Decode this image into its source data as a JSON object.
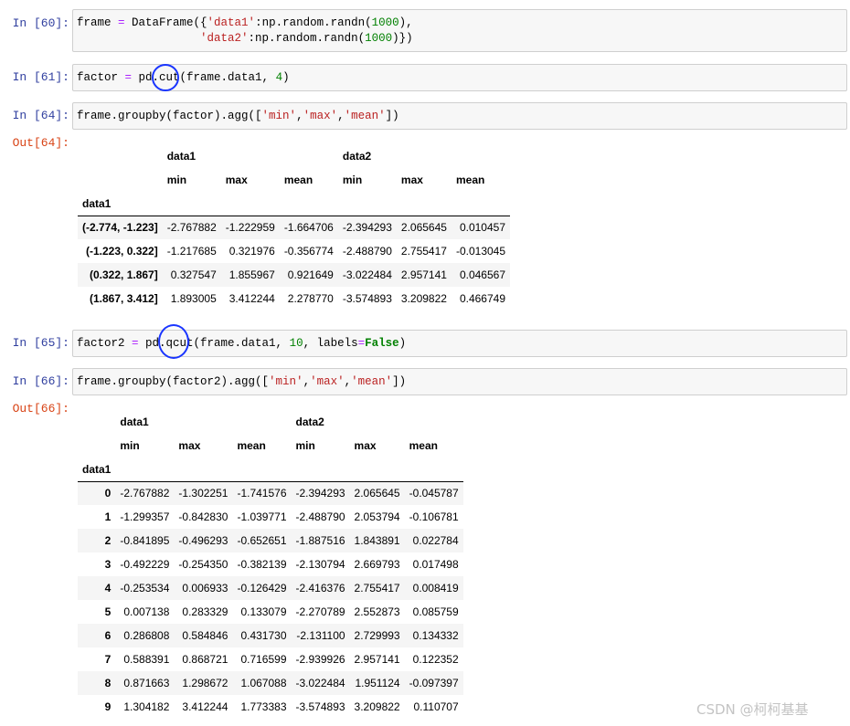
{
  "cells": [
    {
      "prompt": "In  [60]:",
      "lines": [
        [
          [
            "n",
            "frame "
          ],
          [
            "o",
            "="
          ],
          [
            "n",
            " DataFrame({"
          ],
          [
            "s",
            "'data1'"
          ],
          [
            "n",
            ":np.random.randn("
          ],
          [
            "m",
            "1000"
          ],
          [
            "n",
            "),"
          ]
        ],
        [
          [
            "n",
            "                  "
          ],
          [
            "s",
            "'data2'"
          ],
          [
            "n",
            ":np.random.randn("
          ],
          [
            "m",
            "1000"
          ],
          [
            "n",
            ")})"
          ]
        ]
      ]
    },
    {
      "prompt": "In  [61]:",
      "lines": [
        [
          [
            "n",
            "factor "
          ],
          [
            "o",
            "="
          ],
          [
            "n",
            " pd.cut(frame.data1, "
          ],
          [
            "m",
            "4"
          ],
          [
            "n",
            ")"
          ]
        ]
      ]
    },
    {
      "prompt": "In  [64]:",
      "lines": [
        [
          [
            "n",
            "frame.groupby(factor).agg(["
          ],
          [
            "s",
            "'min'"
          ],
          [
            "n",
            ","
          ],
          [
            "s",
            "'max'"
          ],
          [
            "n",
            ","
          ],
          [
            "s",
            "'mean'"
          ],
          [
            "n",
            "])"
          ]
        ]
      ]
    },
    {
      "prompt": "In  [65]:",
      "lines": [
        [
          [
            "n",
            "factor2 "
          ],
          [
            "o",
            "="
          ],
          [
            "n",
            " pd.qcut(frame.data1, "
          ],
          [
            "m",
            "10"
          ],
          [
            "n",
            ", labels"
          ],
          [
            "o",
            "="
          ],
          [
            "k",
            "False"
          ],
          [
            "n",
            ")"
          ]
        ]
      ]
    },
    {
      "prompt": "In  [66]:",
      "lines": [
        [
          [
            "n",
            "frame.groupby(factor2).agg(["
          ],
          [
            "s",
            "'min'"
          ],
          [
            "n",
            ","
          ],
          [
            "s",
            "'max'"
          ],
          [
            "n",
            ","
          ],
          [
            "s",
            "'mean'"
          ],
          [
            "n",
            "])"
          ]
        ]
      ]
    }
  ],
  "outputs": [
    {
      "prompt": "Out[64]:",
      "top_headers": [
        "data1",
        "data2"
      ],
      "sub_headers": [
        "min",
        "max",
        "mean",
        "min",
        "max",
        "mean"
      ],
      "index_name": "data1",
      "rows": [
        {
          "index": "(-2.774, -1.223]",
          "values": [
            "-2.767882",
            "-1.222959",
            "-1.664706",
            "-2.394293",
            "2.065645",
            "0.010457"
          ]
        },
        {
          "index": "(-1.223, 0.322]",
          "values": [
            "-1.217685",
            "0.321976",
            "-0.356774",
            "-2.488790",
            "2.755417",
            "-0.013045"
          ]
        },
        {
          "index": "(0.322, 1.867]",
          "values": [
            "0.327547",
            "1.855967",
            "0.921649",
            "-3.022484",
            "2.957141",
            "0.046567"
          ]
        },
        {
          "index": "(1.867, 3.412]",
          "values": [
            "1.893005",
            "3.412244",
            "2.278770",
            "-3.574893",
            "3.209822",
            "0.466749"
          ]
        }
      ]
    },
    {
      "prompt": "Out[66]:",
      "top_headers": [
        "data1",
        "data2"
      ],
      "sub_headers": [
        "min",
        "max",
        "mean",
        "min",
        "max",
        "mean"
      ],
      "index_name": "data1",
      "rows": [
        {
          "index": "0",
          "values": [
            "-2.767882",
            "-1.302251",
            "-1.741576",
            "-2.394293",
            "2.065645",
            "-0.045787"
          ]
        },
        {
          "index": "1",
          "values": [
            "-1.299357",
            "-0.842830",
            "-1.039771",
            "-2.488790",
            "2.053794",
            "-0.106781"
          ]
        },
        {
          "index": "2",
          "values": [
            "-0.841895",
            "-0.496293",
            "-0.652651",
            "-1.887516",
            "1.843891",
            "0.022784"
          ]
        },
        {
          "index": "3",
          "values": [
            "-0.492229",
            "-0.254350",
            "-0.382139",
            "-2.130794",
            "2.669793",
            "0.017498"
          ]
        },
        {
          "index": "4",
          "values": [
            "-0.253534",
            "0.006933",
            "-0.126429",
            "-2.416376",
            "2.755417",
            "0.008419"
          ]
        },
        {
          "index": "5",
          "values": [
            "0.007138",
            "0.283329",
            "0.133079",
            "-2.270789",
            "2.552873",
            "0.085759"
          ]
        },
        {
          "index": "6",
          "values": [
            "0.286808",
            "0.584846",
            "0.431730",
            "-2.131100",
            "2.729993",
            "0.134332"
          ]
        },
        {
          "index": "7",
          "values": [
            "0.588391",
            "0.868721",
            "0.716599",
            "-2.939926",
            "2.957141",
            "0.122352"
          ]
        },
        {
          "index": "8",
          "values": [
            "0.871663",
            "1.298672",
            "1.067088",
            "-3.022484",
            "1.951124",
            "-0.097397"
          ]
        },
        {
          "index": "9",
          "values": [
            "1.304182",
            "3.412244",
            "1.773383",
            "-3.574893",
            "3.209822",
            "0.110707"
          ]
        }
      ]
    }
  ],
  "watermark": "CSDN @柯柯基基",
  "colors": {
    "in_prompt": "#303f9f",
    "out_prompt": "#d84315",
    "string": "#ba2121",
    "number": "#008000",
    "operator": "#aa22ff",
    "keyword": "#008000",
    "annotation_circle": "#1a35ff"
  }
}
